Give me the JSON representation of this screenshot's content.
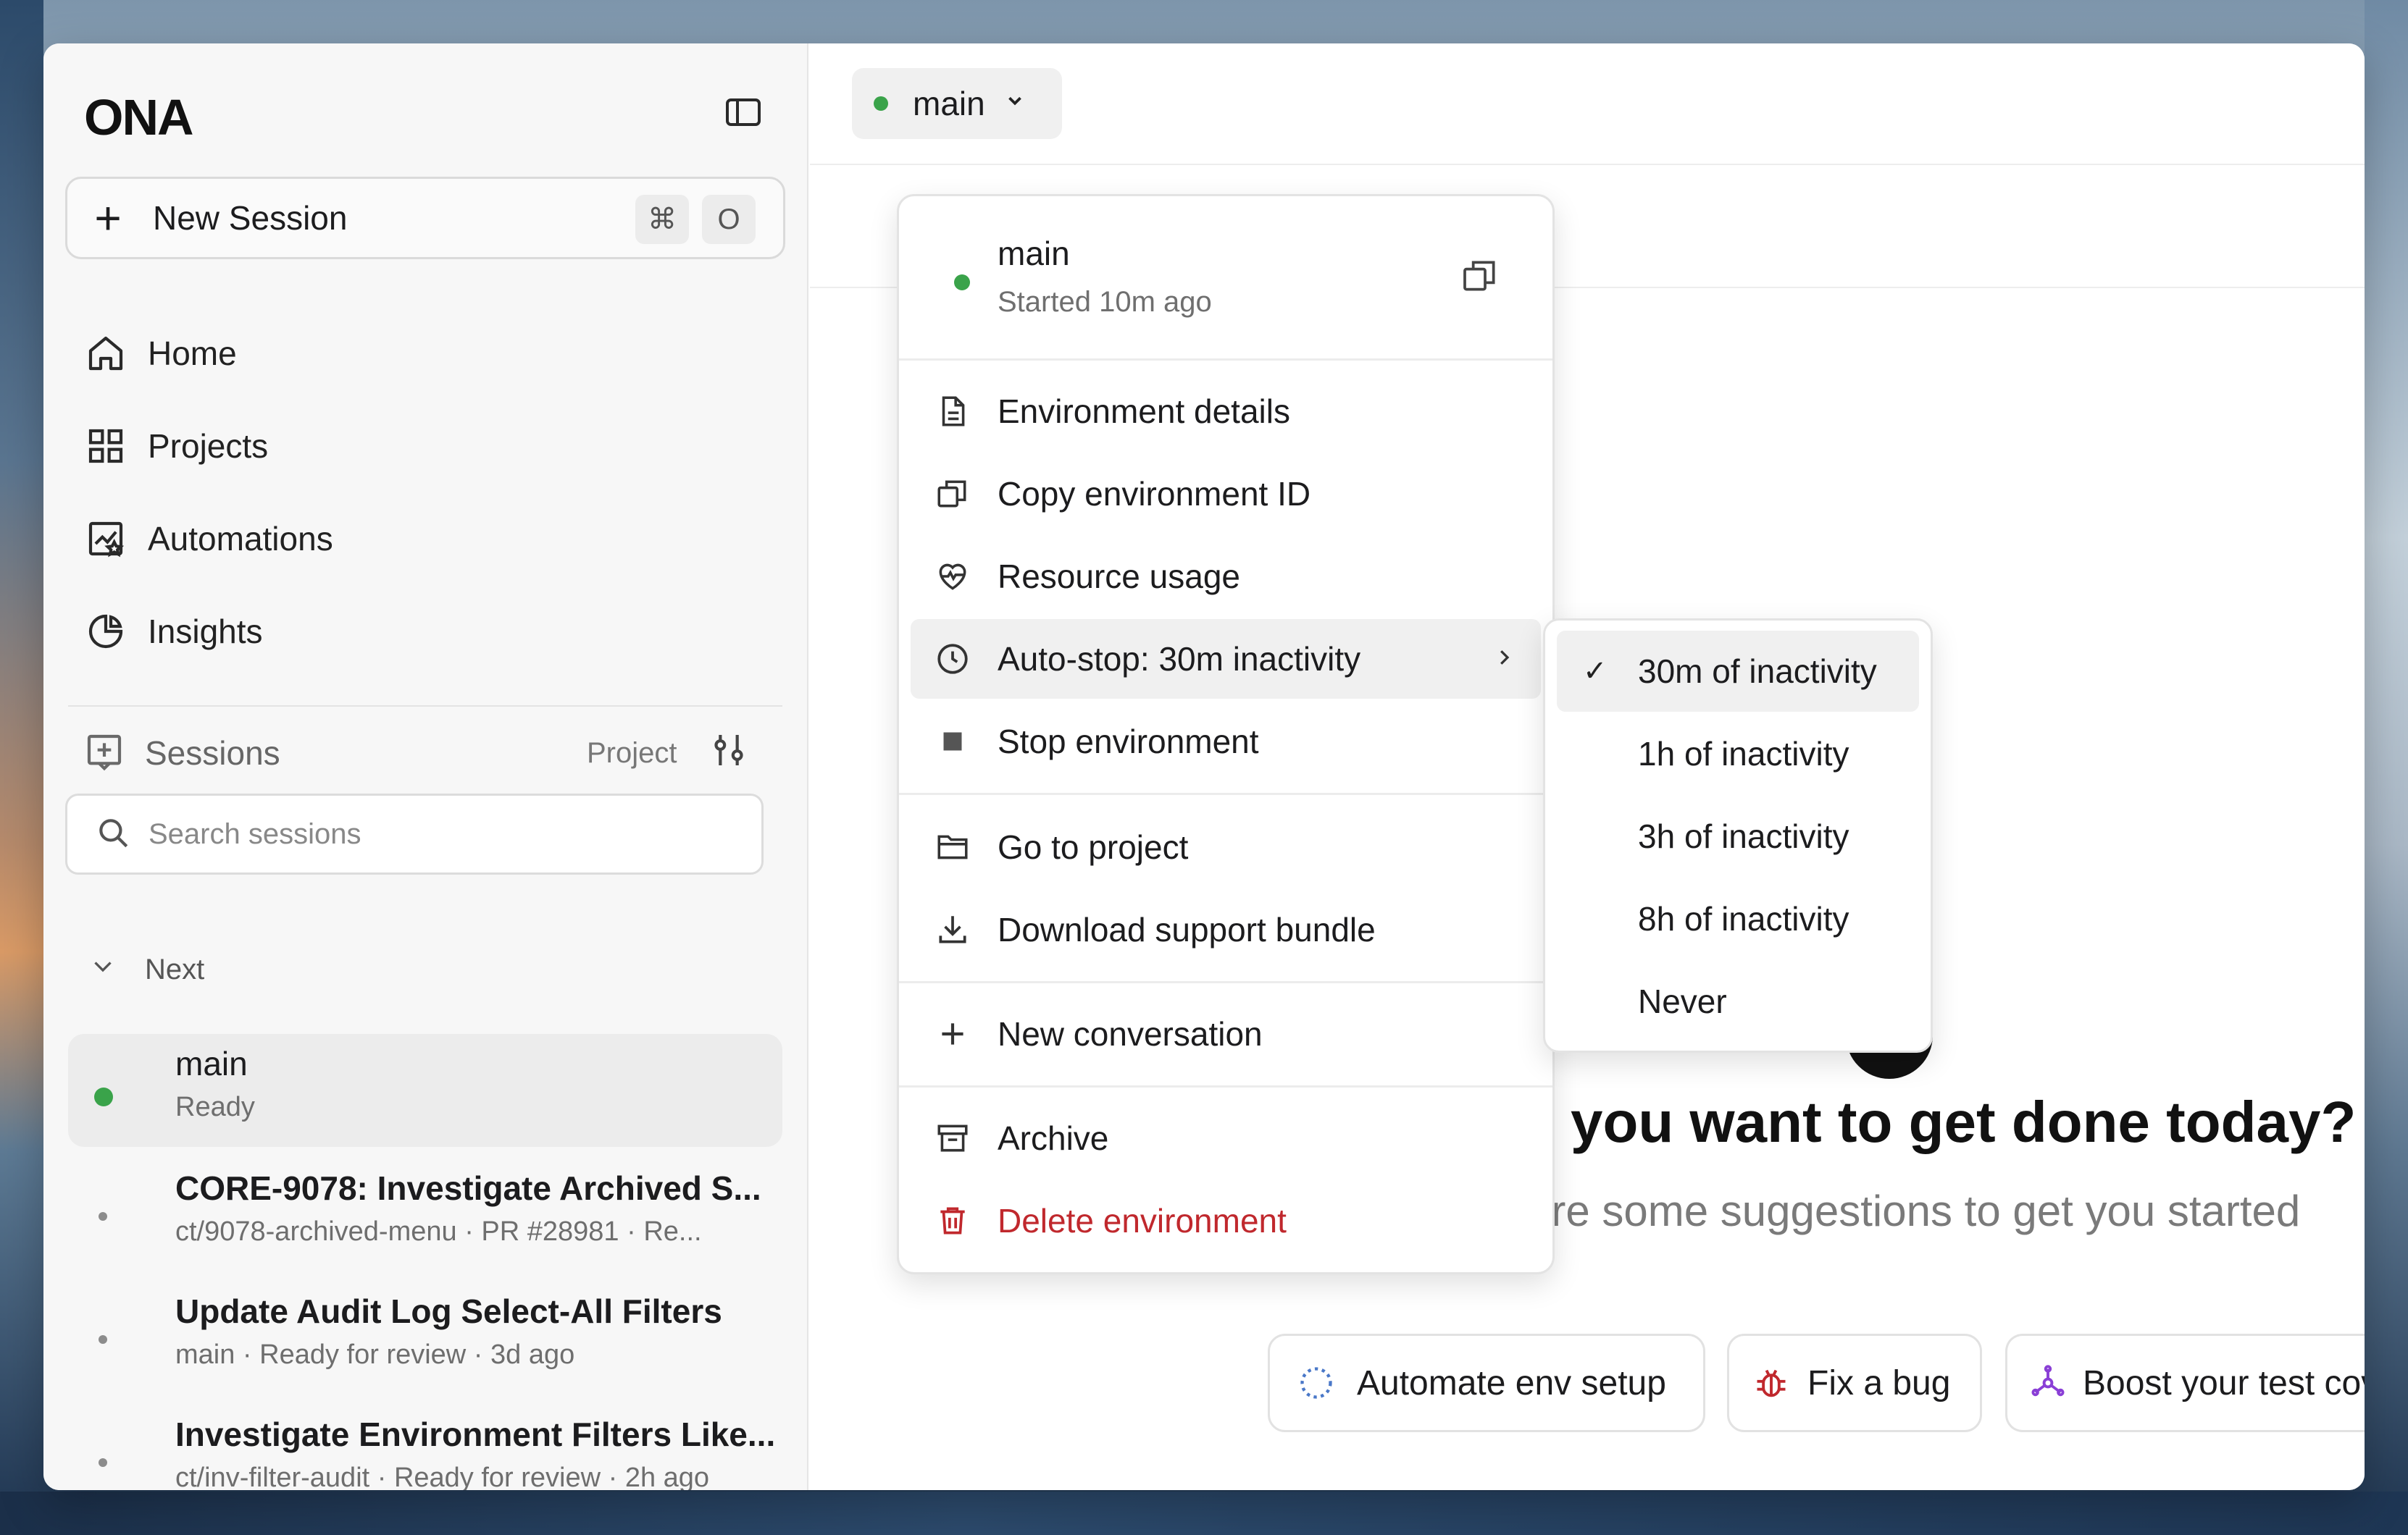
{
  "app": {
    "logo": "ONA"
  },
  "sidebar": {
    "new_session": {
      "label": "New Session",
      "shortcut_cmd": "⌘",
      "shortcut_key": "O"
    },
    "nav": [
      {
        "label": "Home",
        "icon": "home-icon"
      },
      {
        "label": "Projects",
        "icon": "grid-icon"
      },
      {
        "label": "Automations",
        "icon": "automations-icon"
      },
      {
        "label": "Insights",
        "icon": "pie-chart-icon"
      }
    ],
    "sessions_header": {
      "label": "Sessions",
      "project_filter": "Project"
    },
    "search": {
      "placeholder": "Search sessions"
    },
    "group_label": "Next",
    "sessions": [
      {
        "title": "main",
        "subtitle": "Ready",
        "status_color": "#3aa34a",
        "active": true
      },
      {
        "title": "CORE-9078: Investigate Archived S...",
        "subtitle": "ct/9078-archived-menu · PR #28981 · Re...",
        "active": false
      },
      {
        "title": "Update Audit Log Select-All Filters",
        "subtitle": "main · Ready for review · 3d ago",
        "active": false
      },
      {
        "title": "Investigate Environment Filters Like...",
        "subtitle": "ct/inv-filter-audit · Ready for review · 2h ago",
        "active": false
      }
    ]
  },
  "main": {
    "branch_button": {
      "label": "main",
      "status_color": "#3aa34a"
    },
    "hero": {
      "title": "do you want to get done today?",
      "subtitle": "are some suggestions to get you started"
    },
    "suggestions": [
      {
        "label": "Automate env setup",
        "icon": "spinner-icon"
      },
      {
        "label": "Fix a bug",
        "icon": "bug-icon"
      },
      {
        "label": "Boost your test cove",
        "icon": "test-icon"
      }
    ]
  },
  "env_menu": {
    "header": {
      "name": "main",
      "status": "Started 10m ago"
    },
    "items": [
      {
        "label": "Environment details",
        "icon": "document-icon"
      },
      {
        "label": "Copy environment ID",
        "icon": "copy-icon"
      },
      {
        "label": "Resource usage",
        "icon": "heart-pulse-icon"
      },
      {
        "label": "Auto-stop: 30m inactivity",
        "icon": "clock-icon",
        "has_submenu": true
      },
      {
        "label": "Stop environment",
        "icon": "stop-icon"
      },
      {
        "label": "Go to project",
        "icon": "folder-icon"
      },
      {
        "label": "Download support bundle",
        "icon": "download-icon"
      },
      {
        "label": "New conversation",
        "icon": "plus-icon"
      },
      {
        "label": "Archive",
        "icon": "archive-icon"
      },
      {
        "label": "Delete environment",
        "icon": "trash-icon",
        "danger": true
      }
    ]
  },
  "autostop_submenu": {
    "options": [
      {
        "label": "30m of inactivity",
        "selected": true
      },
      {
        "label": "1h of inactivity",
        "selected": false
      },
      {
        "label": "3h of inactivity",
        "selected": false
      },
      {
        "label": "8h of inactivity",
        "selected": false
      },
      {
        "label": "Never",
        "selected": false
      }
    ],
    "check_glyph": "✓"
  },
  "colors": {
    "accent_green": "#3aa34a",
    "danger_red": "#c0282d"
  }
}
